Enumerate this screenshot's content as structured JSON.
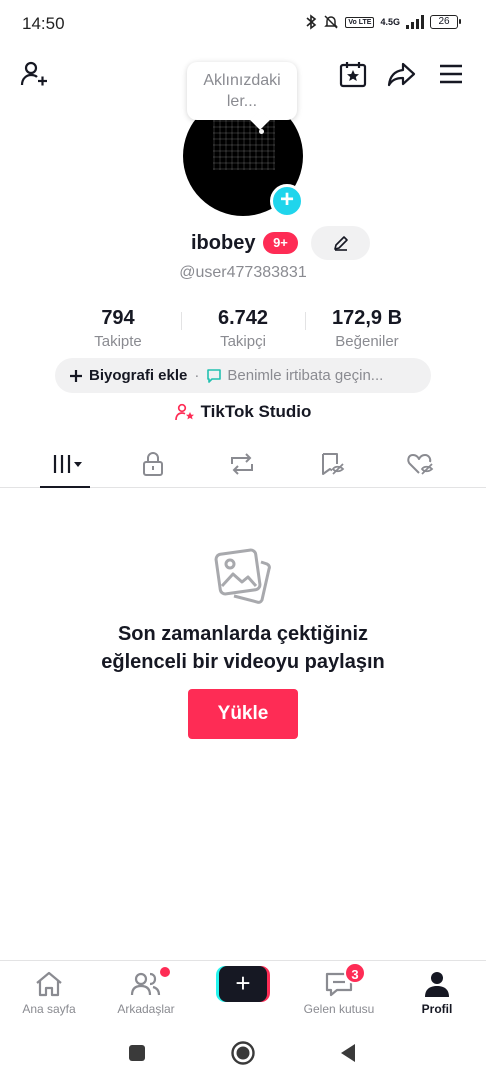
{
  "status_bar": {
    "time": "14:50",
    "network": "4.5G",
    "volte": "Vo LTE",
    "battery": "26",
    "icons": [
      "bluetooth-icon",
      "mute-icon",
      "signal-icon",
      "battery-icon"
    ]
  },
  "header": {
    "left_icon": "add-friend-icon",
    "right_icons": [
      "calendar-star-icon",
      "share-icon",
      "menu-icon"
    ]
  },
  "thought_bubble": {
    "line1": "Aklınızdaki",
    "line2": "ler..."
  },
  "profile": {
    "username": "ibobey",
    "notification_badge": "9+",
    "handle": "@user477383831"
  },
  "stats": [
    {
      "value": "794",
      "label": "Takipte"
    },
    {
      "value": "6.742",
      "label": "Takipçi"
    },
    {
      "value": "172,9 B",
      "label": "Beğeniler"
    }
  ],
  "bio": {
    "add_label": "Biyografi ekle",
    "separator": "·",
    "contact_label": "Benimle irtibata geçin..."
  },
  "studio_link": "TikTok Studio",
  "tabs": [
    {
      "icon": "videos-grid-icon",
      "active": true
    },
    {
      "icon": "lock-icon",
      "active": false
    },
    {
      "icon": "repost-icon",
      "active": false
    },
    {
      "icon": "favorites-icon",
      "active": false
    },
    {
      "icon": "liked-icon",
      "active": false
    }
  ],
  "empty_state": {
    "icon": "photo-stack-icon",
    "line1": "Son zamanlarda çektiğiniz",
    "line2": "eğlenceli bir videoyu paylaşın",
    "button": "Yükle"
  },
  "bottom_nav": [
    {
      "label": "Ana sayfa",
      "icon": "home-icon",
      "active": false
    },
    {
      "label": "Arkadaşlar",
      "icon": "friends-icon",
      "active": false,
      "dot": true
    },
    {
      "label": "",
      "icon": "create-icon",
      "active": false
    },
    {
      "label": "Gelen kutusu",
      "icon": "inbox-icon",
      "active": false,
      "badge": "3"
    },
    {
      "label": "Profil",
      "icon": "profile-icon",
      "active": true
    }
  ],
  "colors": {
    "accent": "#fe2c55",
    "cyan": "#25f4ee",
    "text_primary": "#161823",
    "text_secondary": "#8a8b91",
    "avatar_add": "#20d5ec"
  }
}
